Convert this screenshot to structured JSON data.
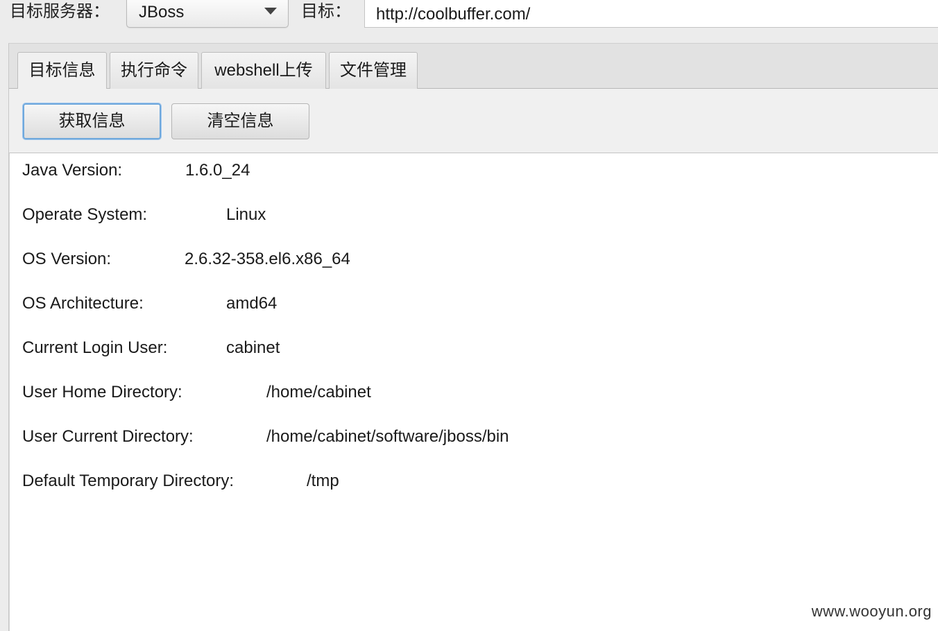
{
  "top_bar": {
    "server_label": "目标服务器：",
    "server_select_value": "JBoss",
    "target_label": "目标：",
    "target_url": "http://coolbuffer.com/"
  },
  "tabs": [
    {
      "label": "目标信息",
      "active": true
    },
    {
      "label": "执行命令",
      "active": false
    },
    {
      "label": "webshell上传",
      "active": false
    },
    {
      "label": "文件管理",
      "active": false
    }
  ],
  "actions": {
    "fetch_label": "获取信息",
    "clear_label": "清空信息"
  },
  "info": [
    {
      "key": "Java Version:",
      "value": "1.6.0_24"
    },
    {
      "key": "Operate System:",
      "value": "Linux"
    },
    {
      "key": "OS Version:",
      "value": "2.6.32-358.el6.x86_64"
    },
    {
      "key": "OS Architecture:",
      "value": "amd64"
    },
    {
      "key": "Current Login User:",
      "value": "cabinet"
    },
    {
      "key": "User Home Directory:",
      "value": "/home/cabinet"
    },
    {
      "key": "User Current Directory:",
      "value": "/home/cabinet/software/jboss/bin"
    },
    {
      "key": "Default Temporary Directory:",
      "value": "/tmp"
    }
  ],
  "watermark": "www.wooyun.org",
  "colors": {
    "focus_ring": "#6fa8dc",
    "window_bg": "#ececec",
    "content_bg": "#ffffff"
  },
  "icons": {
    "server_select_toggle": "chevron-down-icon"
  }
}
